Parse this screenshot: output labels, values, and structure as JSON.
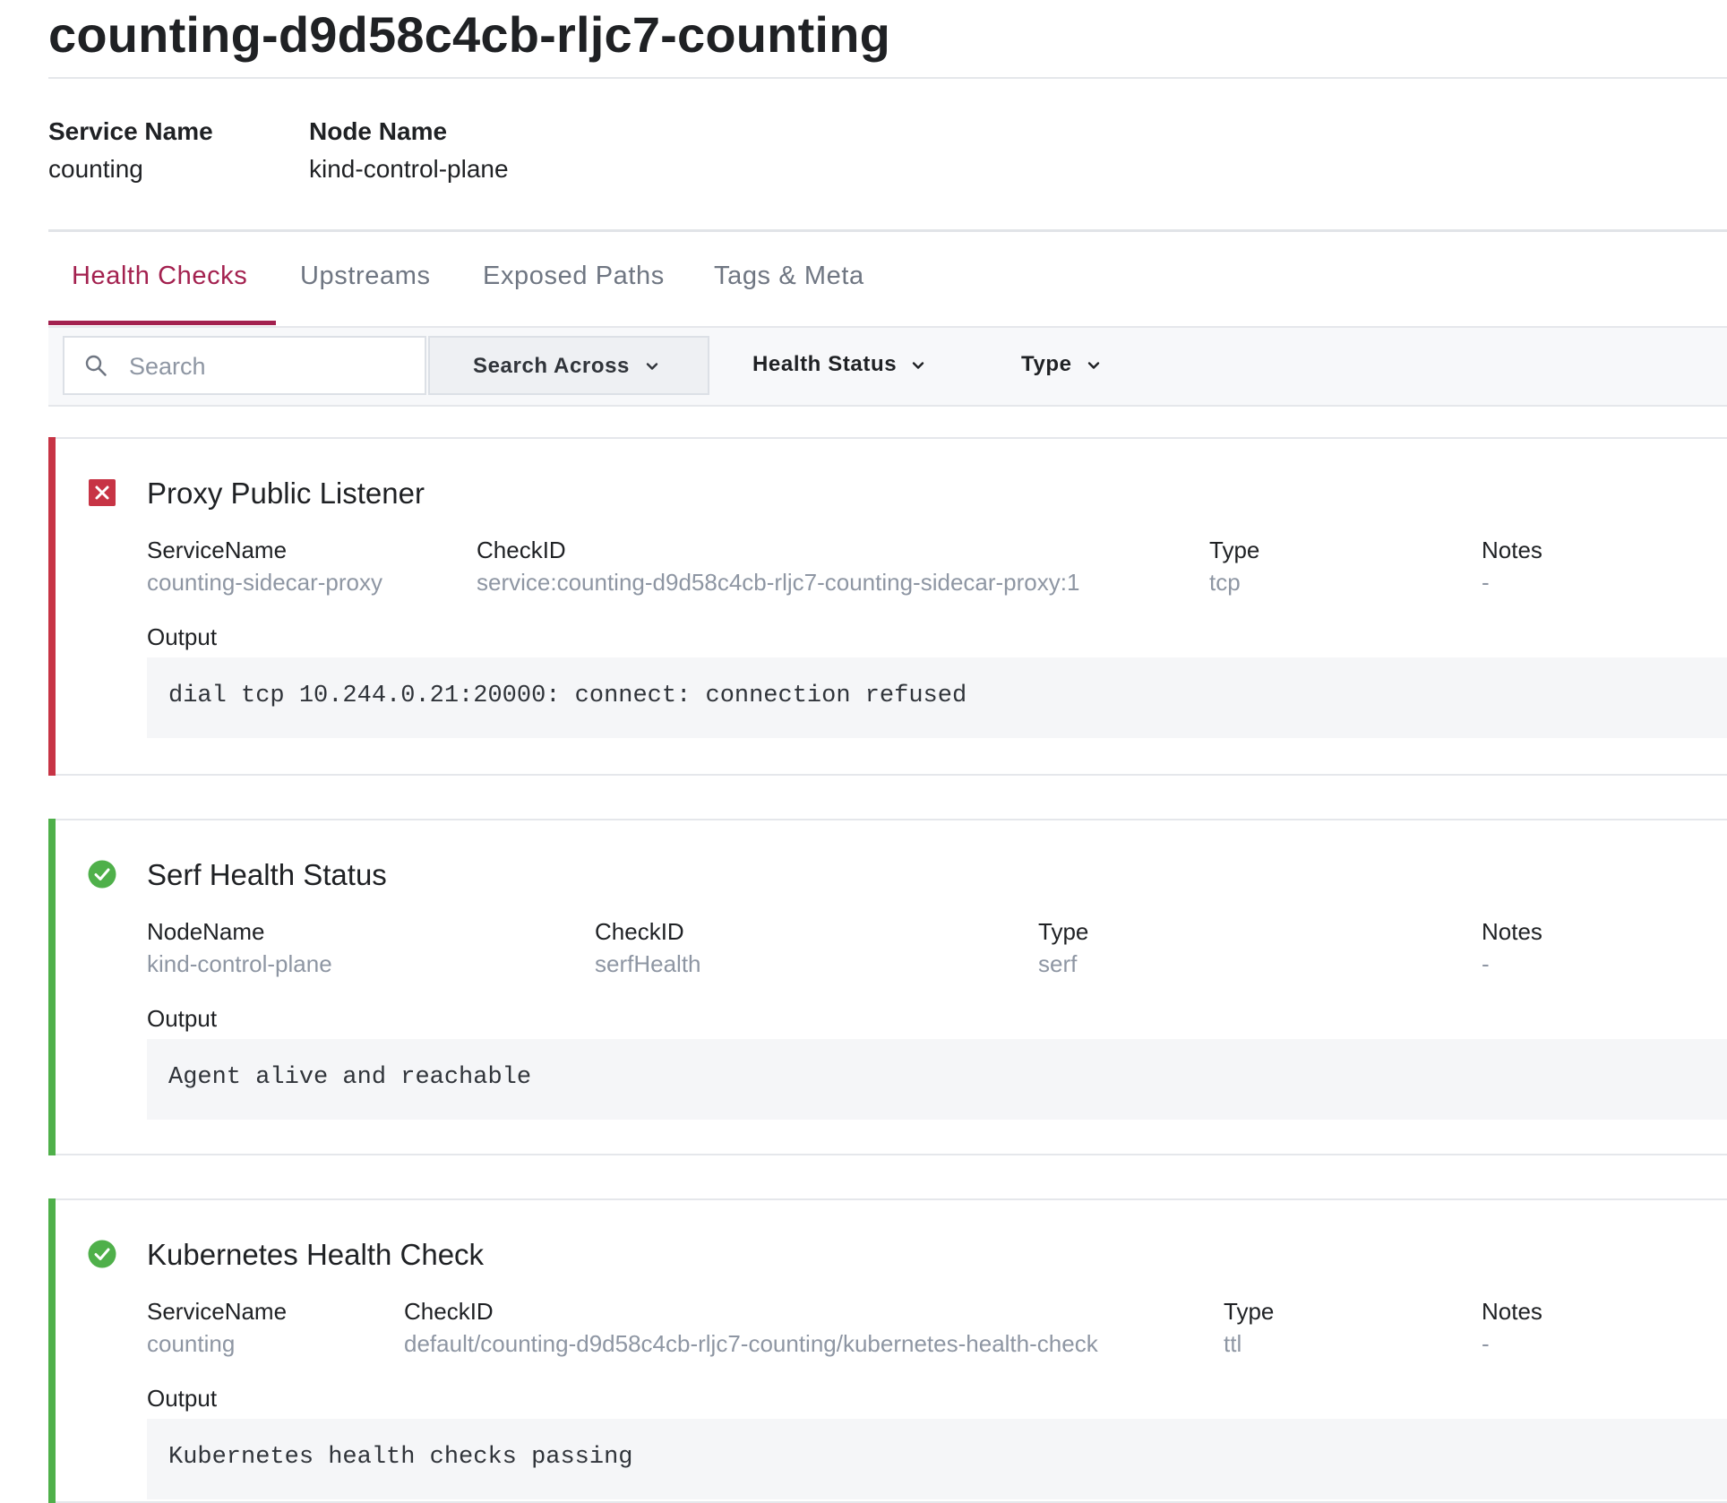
{
  "page": {
    "title": "counting-d9d58c4cb-rljc7-counting"
  },
  "summary": {
    "service_name_label": "Service Name",
    "service_name_value": "counting",
    "node_name_label": "Node Name",
    "node_name_value": "kind-control-plane"
  },
  "tabs": [
    {
      "label": "Health Checks",
      "active": true
    },
    {
      "label": "Upstreams",
      "active": false
    },
    {
      "label": "Exposed Paths",
      "active": false
    },
    {
      "label": "Tags & Meta",
      "active": false
    }
  ],
  "toolbar": {
    "search_placeholder": "Search",
    "search_across_label": "Search Across",
    "health_status_label": "Health Status",
    "type_label": "Type"
  },
  "colors": {
    "accent": "#a3214f",
    "critical": "#c73445",
    "passing": "#4fb04a"
  },
  "checks": [
    {
      "status": "critical",
      "status_icon": "x-square-icon",
      "title": "Proxy Public Listener",
      "fields": [
        {
          "label": "ServiceName",
          "value": "counting-sidecar-proxy"
        },
        {
          "label": "CheckID",
          "value": "service:counting-d9d58c4cb-rljc7-counting-sidecar-proxy:1"
        },
        {
          "label": "Type",
          "value": "tcp"
        },
        {
          "label": "Notes",
          "value": "-"
        }
      ],
      "output_label": "Output",
      "output": "dial tcp 10.244.0.21:20000: connect: connection refused"
    },
    {
      "status": "passing",
      "status_icon": "check-circle-icon",
      "title": "Serf Health Status",
      "fields": [
        {
          "label": "NodeName",
          "value": "kind-control-plane"
        },
        {
          "label": "CheckID",
          "value": "serfHealth"
        },
        {
          "label": "Type",
          "value": "serf"
        },
        {
          "label": "Notes",
          "value": "-"
        }
      ],
      "output_label": "Output",
      "output": "Agent alive and reachable"
    },
    {
      "status": "passing",
      "status_icon": "check-circle-icon",
      "title": "Kubernetes Health Check",
      "fields": [
        {
          "label": "ServiceName",
          "value": "counting"
        },
        {
          "label": "CheckID",
          "value": "default/counting-d9d58c4cb-rljc7-counting/kubernetes-health-check"
        },
        {
          "label": "Type",
          "value": "ttl"
        },
        {
          "label": "Notes",
          "value": "-"
        }
      ],
      "output_label": "Output",
      "output": "Kubernetes health checks passing"
    }
  ]
}
